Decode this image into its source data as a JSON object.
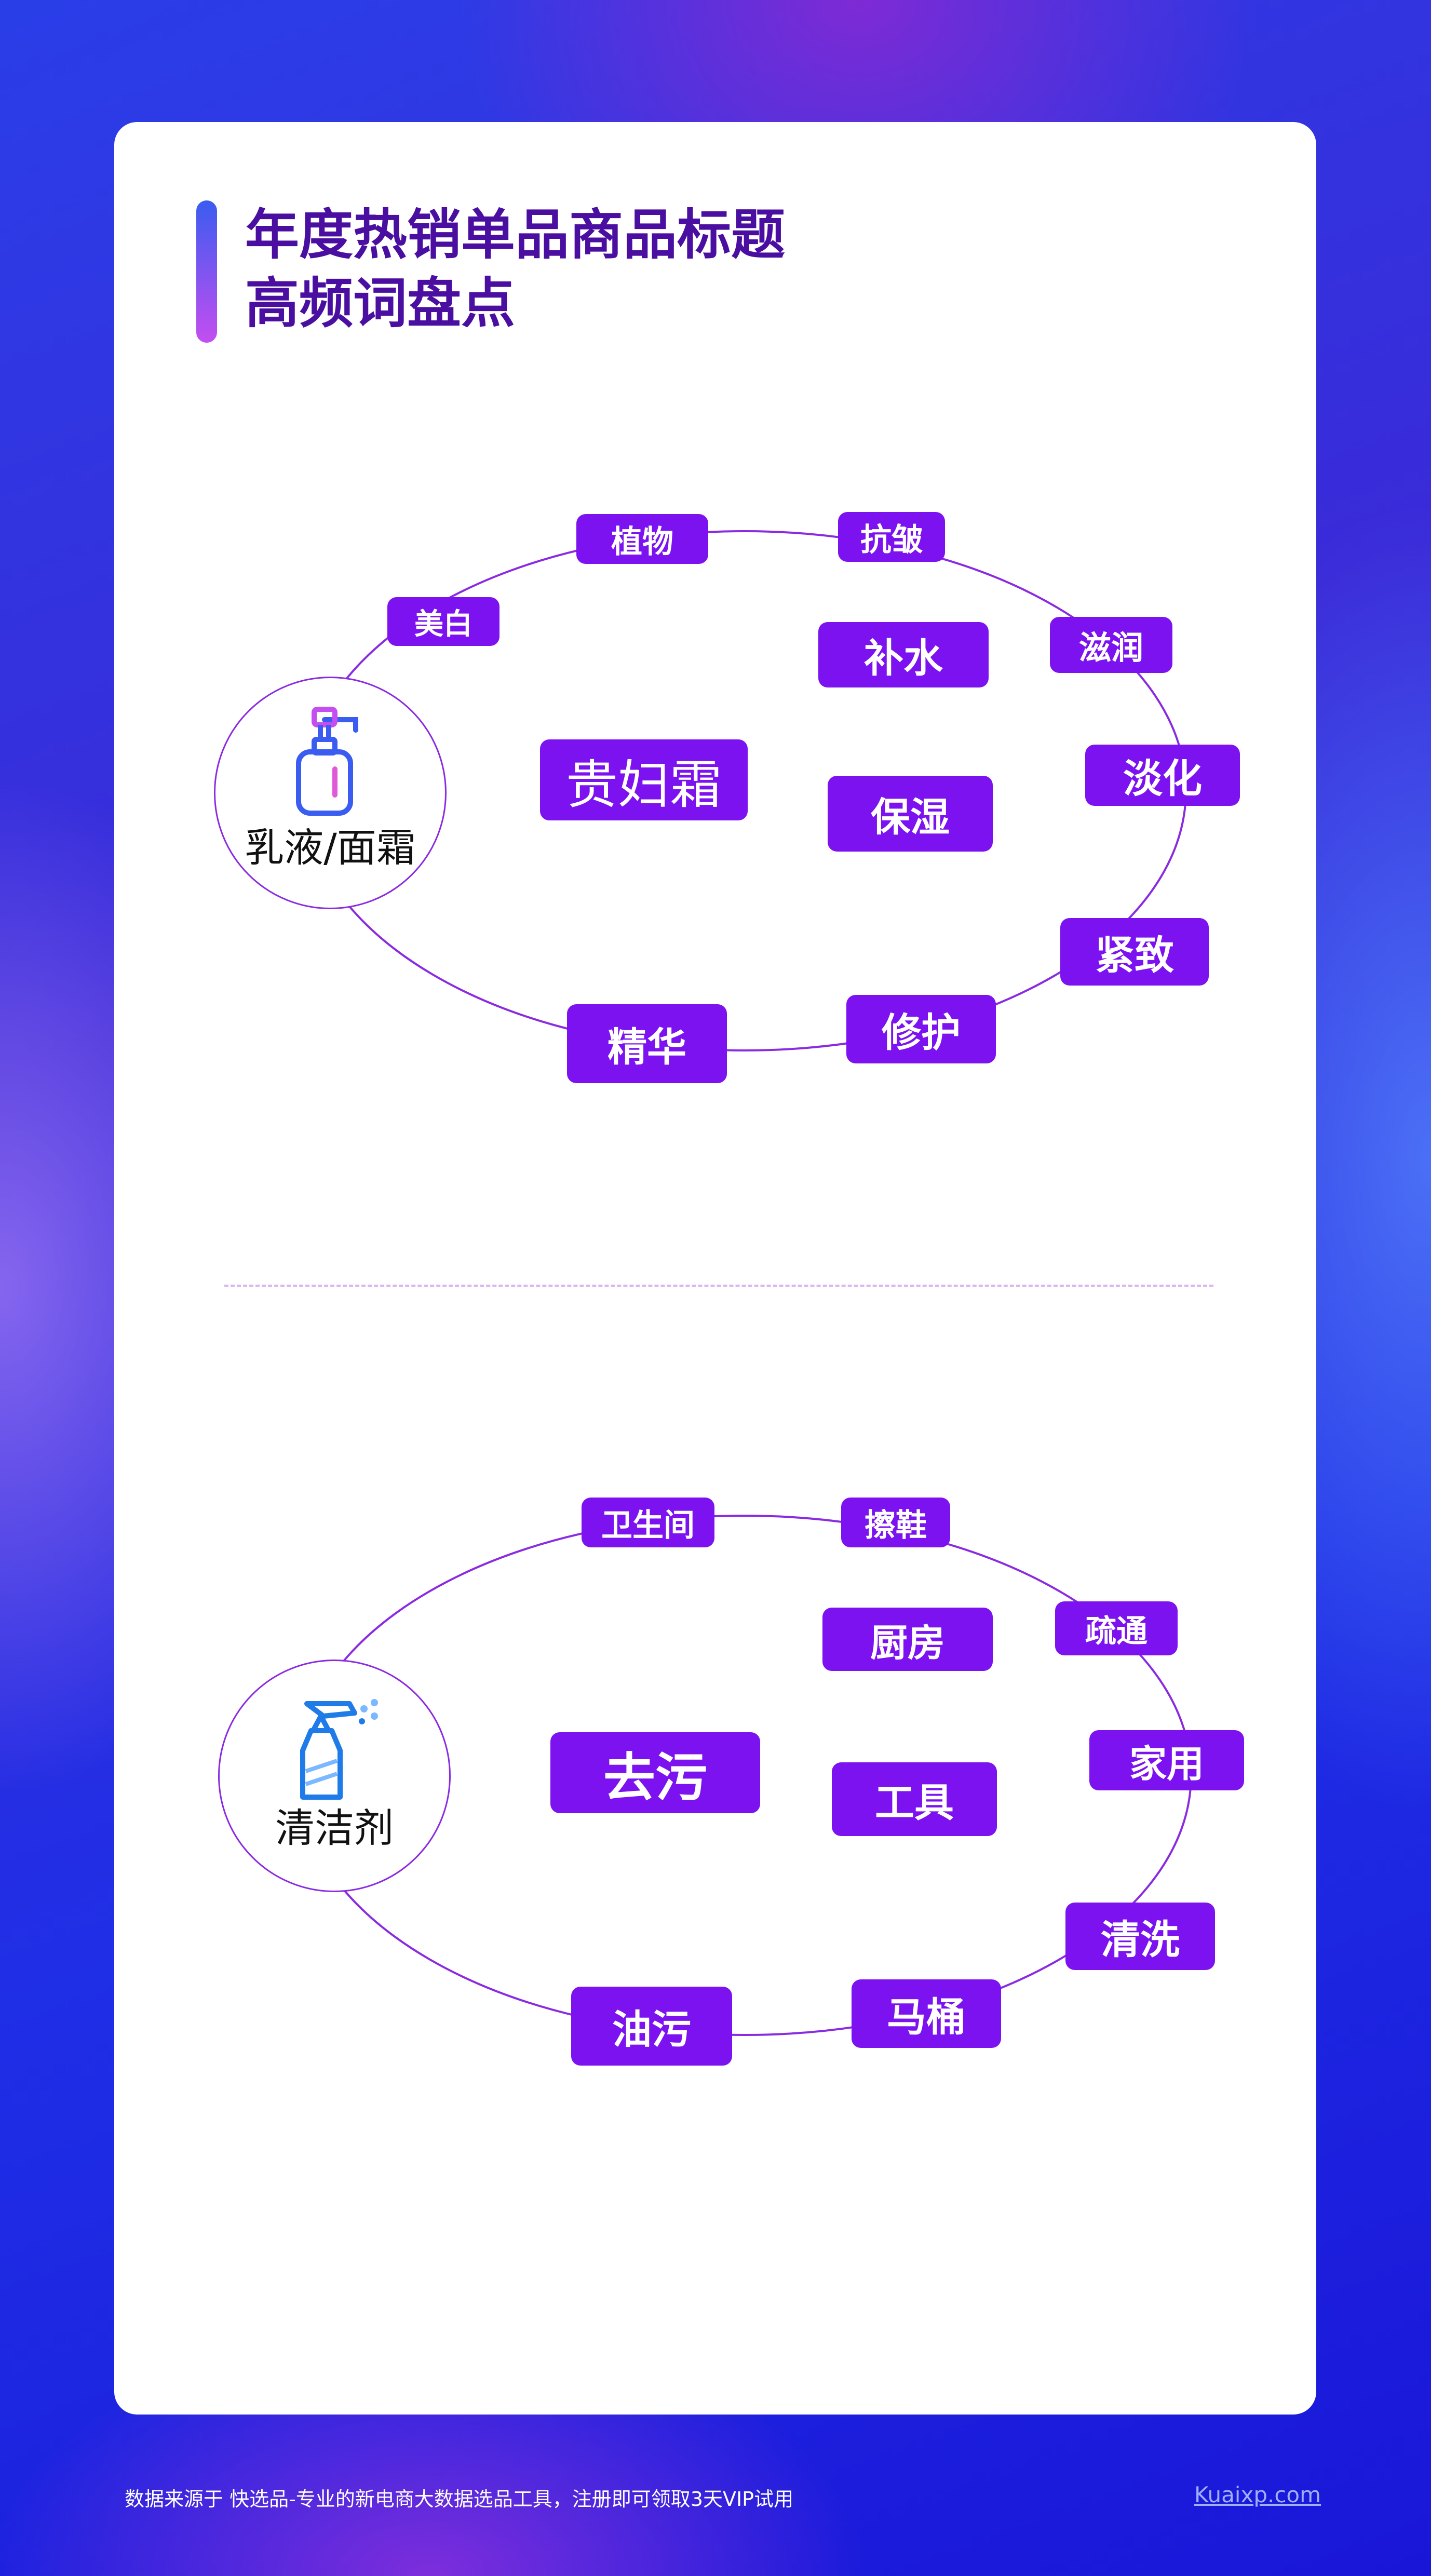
{
  "title": {
    "line1": "年度热销单品商品标题",
    "line2": "高频词盘点"
  },
  "colors": {
    "accent": "#7c12f0",
    "title": "#4a0fa0",
    "ring": "#8a2be2"
  },
  "categories": [
    {
      "label": "乳液/面霜",
      "icon": "lotion-bottle-icon",
      "keywords": [
        "植物",
        "抗皱",
        "美白",
        "补水",
        "滋润",
        "贵妇霜",
        "淡化",
        "保湿",
        "紧致",
        "精华",
        "修护"
      ]
    },
    {
      "label": "清洁剂",
      "icon": "spray-bottle-icon",
      "keywords": [
        "卫生间",
        "擦鞋",
        "厨房",
        "疏通",
        "去污",
        "家用",
        "工具",
        "清洗",
        "油污",
        "马桶"
      ]
    }
  ],
  "footer": {
    "note": "数据来源于 快选品-专业的新电商大数据选品工具，注册即可领取3天VIP试用",
    "link": "Kuaixp.com"
  }
}
